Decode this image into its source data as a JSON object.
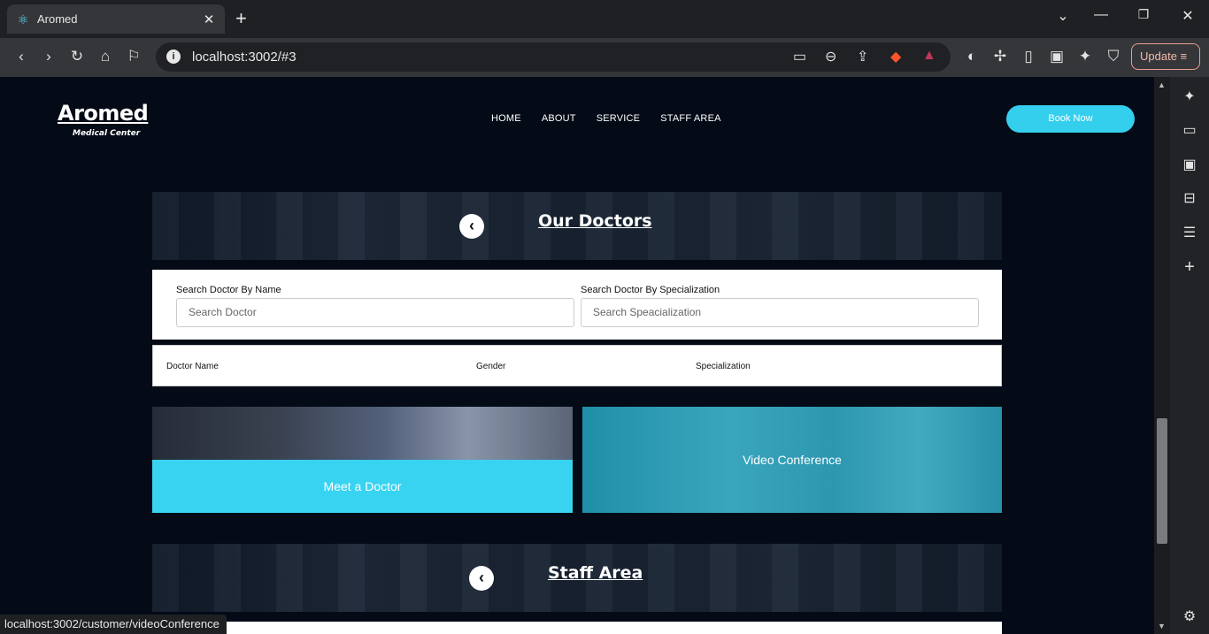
{
  "browser": {
    "tab_title": "Aromed",
    "url": "localhost:3002/#3",
    "update_label": "Update",
    "status_url": "localhost:3002/customer/videoConference"
  },
  "site": {
    "logo": "Aromed",
    "logo_sub": "Medical Center",
    "nav": [
      "HOME",
      "ABOUT",
      "SERVICE",
      "STAFF AREA"
    ],
    "book_now": "Book Now"
  },
  "doctors": {
    "title": "Our Doctors",
    "search_name_label": "Search Doctor By Name",
    "search_name_placeholder": "Search Doctor",
    "search_spec_label": "Search Doctor By Specialization",
    "search_spec_placeholder": "Search Speacialization",
    "columns": [
      "Doctor Name",
      "Gender",
      "Specialization"
    ]
  },
  "cards": {
    "meet": "Meet a Doctor",
    "video": "Video Conference"
  },
  "staff": {
    "title": "Staff Area"
  },
  "colors": {
    "accent": "#35cfee",
    "page_bg": "#040b17"
  }
}
